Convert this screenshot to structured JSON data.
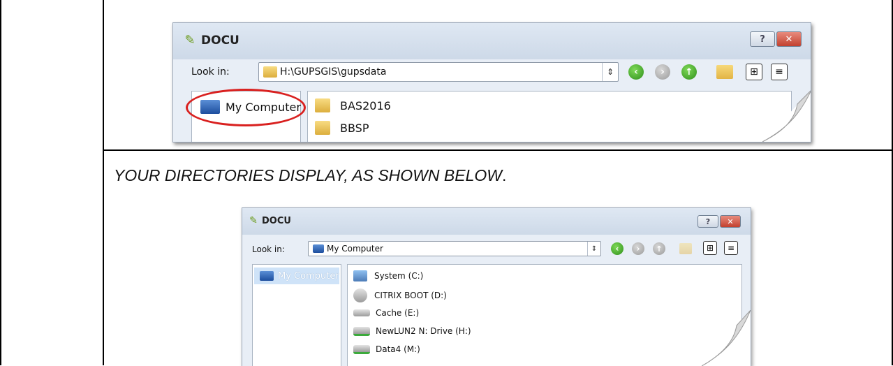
{
  "caption": {
    "text": "YOUR DIRECTORIES DISPLAY, AS SHOWN BELOW",
    "suffix": "."
  },
  "dialog1": {
    "title": "DOCU",
    "help_label": "?",
    "close_label": "✕",
    "look_in_label": "Look in:",
    "path": "H:\\GUPSGIS\\gupsdata",
    "sidebar": [
      {
        "label": "My Computer",
        "icon": "computer-icon"
      }
    ],
    "files": [
      {
        "label": "BAS2016",
        "icon": "folder-icon"
      },
      {
        "label": "BBSP",
        "icon": "folder-icon"
      }
    ]
  },
  "dialog2": {
    "title": "DOCU",
    "help_label": "?",
    "close_label": "✕",
    "look_in_label": "Look in:",
    "path": "My Computer",
    "sidebar": [
      {
        "label": "My Computer",
        "icon": "computer-icon"
      }
    ],
    "files": [
      {
        "label": "System (C:)",
        "icon": "system-drive-icon"
      },
      {
        "label": "CITRIX BOOT (D:)",
        "icon": "dvd-drive-icon"
      },
      {
        "label": "Cache (E:)",
        "icon": "hard-drive-icon"
      },
      {
        "label": "NewLUN2 N: Drive (H:)",
        "icon": "network-drive-icon"
      },
      {
        "label": "Data4 (M:)",
        "icon": "network-drive-icon"
      }
    ]
  },
  "colors": {
    "annotation_circle": "#d9201f",
    "titlebar": "#cdd9e8",
    "selection": "#cfe3f8"
  }
}
